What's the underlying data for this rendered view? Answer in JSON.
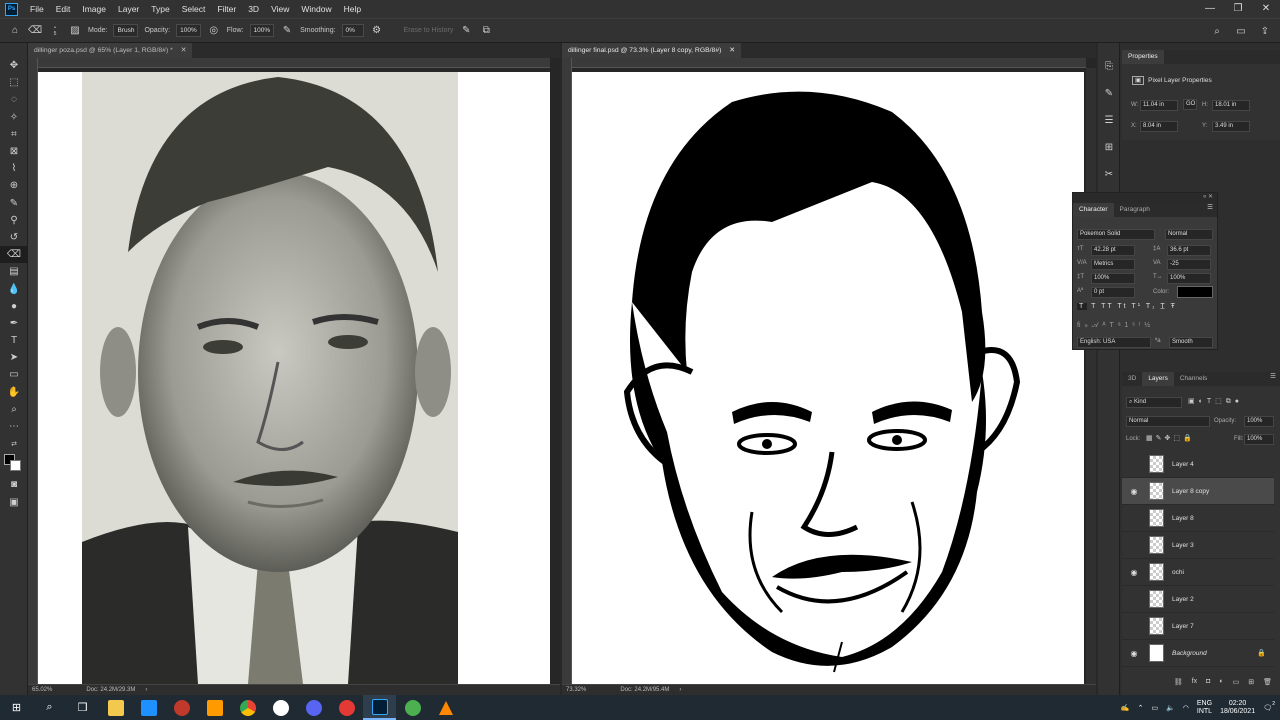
{
  "menubar": {
    "logo": "Ps",
    "items": [
      "File",
      "Edit",
      "Image",
      "Layer",
      "Type",
      "Select",
      "Filter",
      "3D",
      "View",
      "Window",
      "Help"
    ]
  },
  "options_bar": {
    "mode_label": "Mode:",
    "mode_value": "Brush",
    "opacity_label": "Opacity:",
    "opacity_value": "100%",
    "flow_label": "Flow:",
    "flow_value": "100%",
    "smoothing_label": "Smoothing:",
    "smoothing_value": "0%",
    "erase_history": "Erase to History",
    "brush_size": "5"
  },
  "docs": {
    "left": {
      "tab": "dillinger poza.psd @ 65% (Layer 1, RGB/8#) *",
      "zoom": "65.02%",
      "doc": "Doc: 24.2M/29.3M"
    },
    "right": {
      "tab": "dillinger final.psd @ 73.3% (Layer 8 copy, RGB/8#)",
      "zoom": "73.32%",
      "doc": "Doc: 24.2M/95.4M"
    }
  },
  "properties": {
    "tab": "Properties",
    "title": "Pixel Layer Properties",
    "w_label": "W:",
    "w": "11.04 in",
    "go": "GO",
    "h_label": "H:",
    "h": "18.01 in",
    "x_label": "X:",
    "x": "8.04 in",
    "y_label": "Y:",
    "y": "3.49 in"
  },
  "character": {
    "tab_character": "Character",
    "tab_paragraph": "Paragraph",
    "font_family": "Pokemon Solid",
    "font_style": "Normal",
    "size": "42.28 pt",
    "leading": "36.6 pt",
    "kerning": "Metrics",
    "tracking": "-25",
    "vscale": "100%",
    "hscale": "100%",
    "baseline": "0 pt",
    "color_label": "Color:",
    "language": "English: USA",
    "antialias": "Smooth",
    "color": "#000000"
  },
  "layers_panel": {
    "tabs": [
      "3D",
      "Layers",
      "Channels"
    ],
    "filter": "Kind",
    "blend_mode": "Normal",
    "opacity_label": "Opacity:",
    "opacity": "100%",
    "lock_label": "Lock:",
    "fill_label": "Fill:",
    "fill": "100%",
    "layers": [
      {
        "name": "Layer 4",
        "visible": false
      },
      {
        "name": "Layer 8 copy",
        "visible": true
      },
      {
        "name": "Layer 8",
        "visible": false
      },
      {
        "name": "Layer 3",
        "visible": false
      },
      {
        "name": "ochi",
        "visible": true
      },
      {
        "name": "Layer 2",
        "visible": false
      },
      {
        "name": "Layer 7",
        "visible": false
      },
      {
        "name": "Background",
        "visible": true
      }
    ]
  },
  "taskbar": {
    "lang1": "ENG",
    "lang2": "INTL",
    "time": "02:20",
    "date": "18/06/2021",
    "notifications": "2"
  }
}
